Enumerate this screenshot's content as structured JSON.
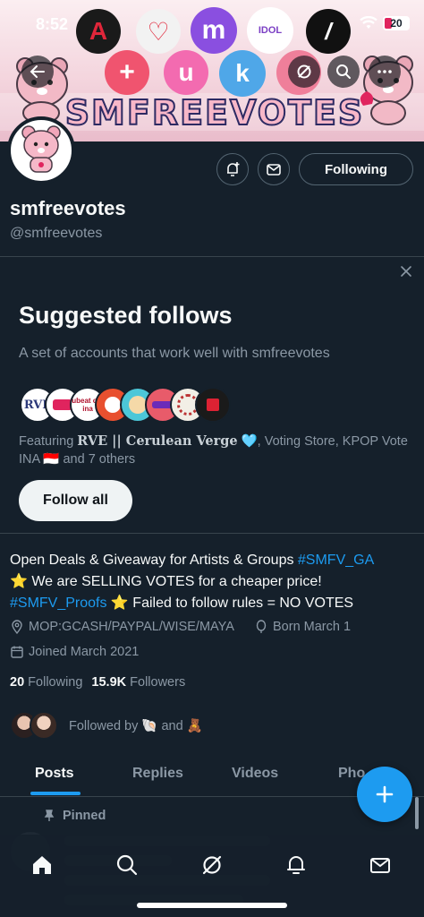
{
  "status_bar": {
    "time": "8:52",
    "battery": "20"
  },
  "banner": {
    "title": "SMFREEVOTES",
    "logos": [
      {
        "name": "a-logo",
        "color": "#1a1a1a",
        "glyph": "A"
      },
      {
        "name": "heart-logo",
        "color": "#f2f2f2",
        "glyph": "♡"
      },
      {
        "name": "m-logo",
        "color": "#8a4fe0",
        "glyph": "m"
      },
      {
        "name": "idol-logo",
        "color": "#ffffff",
        "glyph": "IDOL"
      },
      {
        "name": "slash-logo",
        "color": "#111111",
        "glyph": "/"
      },
      {
        "name": "plus-logo",
        "color": "#f0546f",
        "glyph": "+"
      },
      {
        "name": "u-logo",
        "color": "#f36bb0",
        "glyph": "u"
      },
      {
        "name": "k-logo",
        "color": "#4fa7e8",
        "glyph": "k"
      },
      {
        "name": "pink-logo",
        "color": "#ef7f9a",
        "glyph": ""
      }
    ]
  },
  "profile": {
    "display_name": "smfreevotes",
    "handle": "@smfreevotes",
    "following_button": "Following"
  },
  "suggested": {
    "title": "Suggested follows",
    "subtitle": "A set of accounts that work well with smfreevotes",
    "faces": [
      {
        "label": "RVE",
        "color": "#ffffff"
      },
      {
        "label": "",
        "color": "#ffffff"
      },
      {
        "label": "ubeat ote ina",
        "color": "#ffffff"
      },
      {
        "label": "",
        "color": "#e8502f"
      },
      {
        "label": "",
        "color": "#4cc7d8"
      },
      {
        "label": "",
        "color": "#e85b6a"
      },
      {
        "label": "",
        "color": "#f2efe6"
      },
      {
        "label": "",
        "color": "#1a1a1a"
      }
    ],
    "featuring_prefix": "Featuring ",
    "featuring_bold": "RVE || Cerulean Verge",
    "featuring_rest": " 🩵, Voting Store, KPOP Vote INA 🇮🇩 and 7 others",
    "follow_all": "Follow all"
  },
  "bio": {
    "line1_text": "Open Deals & Giveaway for Artists & Groups ",
    "line1_tag": "#SMFV_GA",
    "line2_text": "⭐ We are SELLING VOTES for a cheaper price!",
    "line3_tag": "#SMFV_Proofs",
    "line3_text": " ⭐ Failed to follow rules = NO VOTES"
  },
  "meta": {
    "location": "MOP:GCASH/PAYPAL/WISE/MAYA",
    "born": "Born March 1",
    "joined": "Joined March 2021"
  },
  "counts": {
    "following_num": "20",
    "following_label": "Following",
    "followers_num": "15.9K",
    "followers_label": "Followers"
  },
  "followed_by": {
    "text": "Followed by 🐚 and 🧸"
  },
  "tabs": [
    {
      "label": "Posts"
    },
    {
      "label": "Replies"
    },
    {
      "label": "Videos"
    },
    {
      "label": "Pho"
    }
  ],
  "pinned": {
    "label": "Pinned"
  },
  "colors": {
    "accent": "#1d9bf0",
    "background": "#15202b",
    "muted": "#8b98a5"
  }
}
